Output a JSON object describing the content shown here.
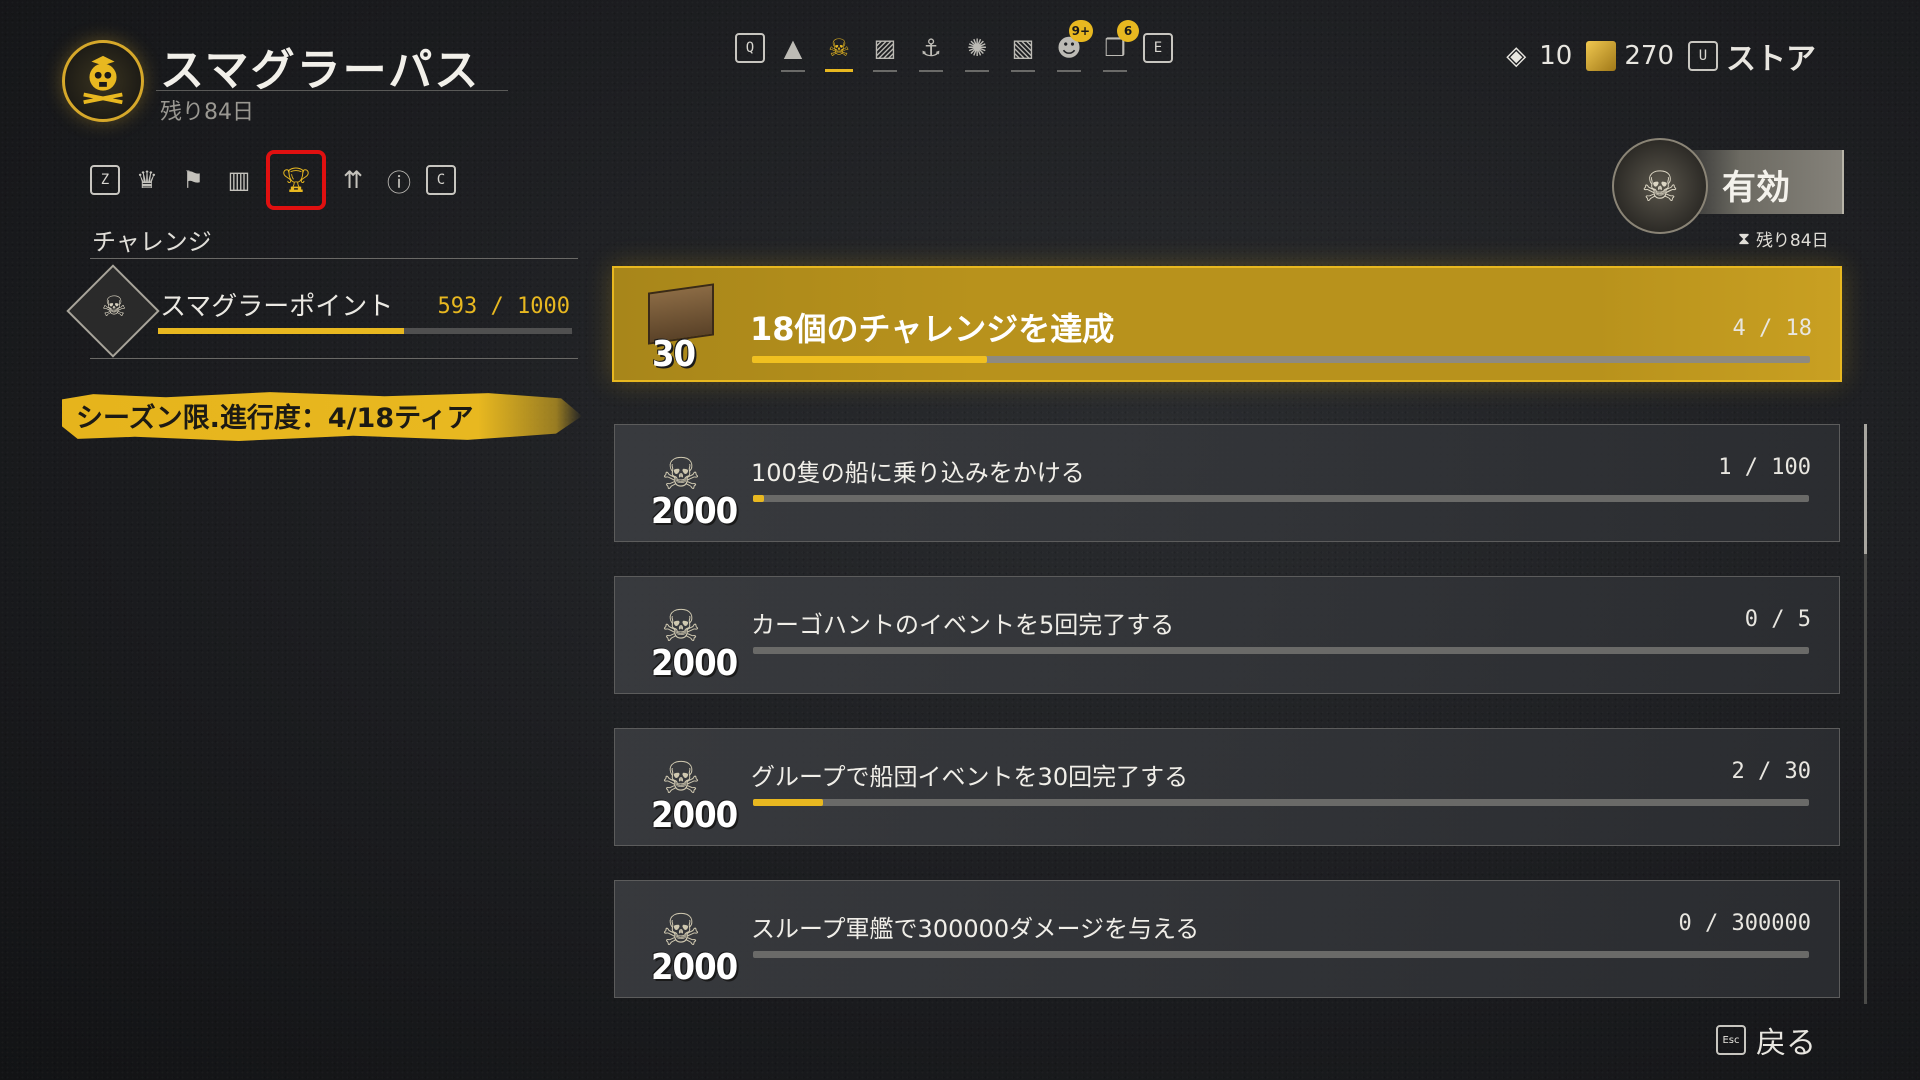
{
  "header": {
    "title": "スマグラーパス",
    "subtitle": "残り84日"
  },
  "topnav": {
    "left_key": "Q",
    "right_key": "E",
    "icons": [
      "ranking-icon",
      "smuggler-pass-icon",
      "map-icon",
      "faction-icon",
      "kraken-icon",
      "contract-icon",
      "mask-icon",
      "journal-icon"
    ],
    "badges": {
      "mask": "9+",
      "journal": "6"
    }
  },
  "currencies": {
    "helm_tokens": "10",
    "gold": "270",
    "store_key": "U",
    "store_label": "ストア"
  },
  "subnav": {
    "left_key": "Z",
    "right_key": "C",
    "icons": [
      "rank-icon",
      "flag-icon",
      "gift-icon",
      "trophy-icon",
      "upgrade-icon",
      "info-icon"
    ]
  },
  "left": {
    "section_label": "チャレンジ",
    "smuggler_points_label": "スマグラーポイント",
    "smuggler_points_value": "593 / 1000",
    "smuggler_points_progress": 0.593,
    "season_progress": "シーズン限.進行度：4/18ティア"
  },
  "status": {
    "active_label": "有効",
    "remaining": "残り84日"
  },
  "challenges": [
    {
      "title": "18個のチャレンジを達成",
      "count": "4 / 18",
      "reward": "30",
      "progress": 0.2222,
      "featured": true
    },
    {
      "title": "100隻の船に乗り込みをかける",
      "count": "1 / 100",
      "reward": "2000",
      "progress": 0.01,
      "featured": false
    },
    {
      "title": "カーゴハントのイベントを5回完了する",
      "count": "0 / 5",
      "reward": "2000",
      "progress": 0,
      "featured": false
    },
    {
      "title": "グループで船団イベントを30回完了する",
      "count": "2 / 30",
      "reward": "2000",
      "progress": 0.0667,
      "featured": false
    },
    {
      "title": "スループ軍艦で300000ダメージを与える",
      "count": "0 / 300000",
      "reward": "2000",
      "progress": 0,
      "featured": false
    }
  ],
  "footer": {
    "esc_key": "Esc",
    "back_label": "戻る"
  },
  "colors": {
    "accent": "#e8b820",
    "selected_outline": "#e01010"
  }
}
